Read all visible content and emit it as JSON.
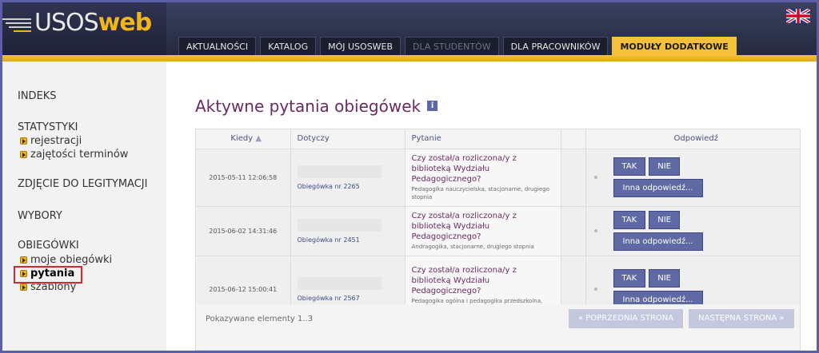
{
  "header": {
    "logo_main": "USOS",
    "logo_accent": "web",
    "nav": [
      {
        "label": "AKTUALNOŚCI",
        "state": "normal"
      },
      {
        "label": "KATALOG",
        "state": "normal"
      },
      {
        "label": "MÓJ USOSWEB",
        "state": "normal"
      },
      {
        "label": "DLA STUDENTÓW",
        "state": "disabled"
      },
      {
        "label": "DLA PRACOWNIKÓW",
        "state": "normal"
      },
      {
        "label": "MODUŁY DODATKOWE",
        "state": "active"
      }
    ],
    "language_flag_icon": "uk-flag-icon"
  },
  "sidebar": {
    "indeks": "INDEKS",
    "statystyki": "STATYSTYKI",
    "statystyki_items": [
      "rejestracji",
      "zajętości terminów"
    ],
    "zdjecie": "ZDJĘCIE DO LEGITYMACJI",
    "wybory": "WYBORY",
    "obiegowki": "OBIEGÓWKI",
    "obiegowki_items": [
      "moje obiegówki",
      "pytania",
      "szablony"
    ],
    "active_item": "pytania"
  },
  "main": {
    "title": "Aktywne pytania obiegówek",
    "info_icon": "info-icon",
    "columns": {
      "date": "Kiedy",
      "relates": "Dotyczy",
      "question": "Pytanie",
      "answer": "Odpowiedź"
    },
    "rows": [
      {
        "date": "2015-05-11 12:06:58",
        "relates": "Obiegówka nr 2265",
        "question": "Czy został/a rozliczona/y z biblioteką Wydziału Pedagogicznego?",
        "details": "Pedagogika nauczycielska, stacjonarne, drugiego stopnia"
      },
      {
        "date": "2015-06-02 14:31:46",
        "relates": "Obiegówka nr 2451",
        "question": "Czy został/a rozliczona/y z biblioteką Wydziału Pedagogicznego?",
        "details": "Andragogika, stacjonarne, drugiego stopnia"
      },
      {
        "date": "2015-06-12 15:00:41",
        "relates": "Obiegówka nr 2567",
        "question": "Czy został/a rozliczona/y z biblioteką Wydziału Pedagogicznego?",
        "details": "Pedagogika ogólna i pedagogika przedszkolna, niestacjonarne (zaoczne), drugiego stopnia"
      }
    ],
    "buttons": {
      "yes": "TAK",
      "no": "NIE",
      "other": "Inna odpowiedź..."
    },
    "shown": "Pokazywane elementy 1..3",
    "prev_page": "« POPRZEDNIA STRONA",
    "next_page": "NASTĘPNA STRONA »"
  },
  "colors": {
    "accent": "#f6c13a",
    "title": "#6b2a61",
    "button": "#5f69a3",
    "highlight": "#d8262e"
  }
}
